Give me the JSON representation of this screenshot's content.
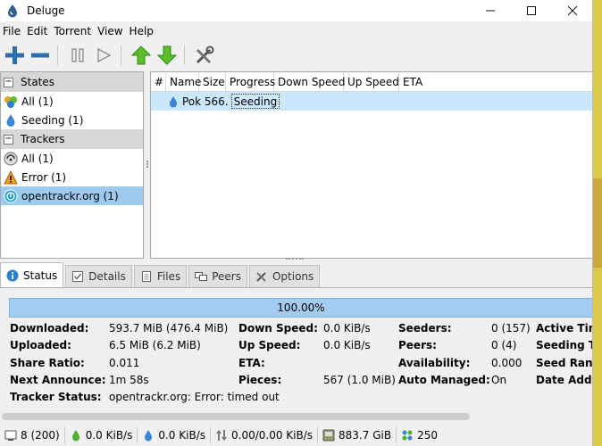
{
  "window": {
    "title": "Deluge"
  },
  "menu": [
    "File",
    "Edit",
    "Torrent",
    "View",
    "Help"
  ],
  "sidebar": {
    "sections": [
      {
        "header": "States",
        "items": [
          {
            "label": "All (1)"
          },
          {
            "label": "Seeding (1)"
          }
        ]
      },
      {
        "header": "Trackers",
        "items": [
          {
            "label": "All (1)"
          },
          {
            "label": "Error (1)"
          },
          {
            "label": "opentrackr.org (1)"
          }
        ]
      }
    ]
  },
  "torrent_list": {
    "columns": [
      "#",
      "Name",
      "Size",
      "Progress",
      "Down Speed",
      "Up Speed",
      "ETA"
    ],
    "rows": [
      {
        "name": "Pok 566.",
        "progress": "Seeding"
      }
    ]
  },
  "tabs": [
    "Status",
    "Details",
    "Files",
    "Peers",
    "Options"
  ],
  "status": {
    "progress_text": "100.00%",
    "fields": {
      "downloaded_label": "Downloaded:",
      "downloaded_value": "593.7 MiB (476.4 MiB)",
      "uploaded_label": "Uploaded:",
      "uploaded_value": "6.5 MiB (6.2 MiB)",
      "share_ratio_label": "Share Ratio:",
      "share_ratio_value": "0.011",
      "next_announce_label": "Next Announce:",
      "next_announce_value": "1m 58s",
      "tracker_status_label": "Tracker Status:",
      "tracker_status_value": "opentrackr.org: Error: timed out",
      "down_speed_label": "Down Speed:",
      "down_speed_value": "0.0 KiB/s",
      "up_speed_label": "Up Speed:",
      "up_speed_value": "0.0 KiB/s",
      "eta_label": "ETA:",
      "pieces_label": "Pieces:",
      "pieces_value": "567 (1.0 MiB)",
      "seeders_label": "Seeders:",
      "seeders_value": "0 (157)",
      "peers_label": "Peers:",
      "peers_value": "0 (4)",
      "availability_label": "Availability:",
      "availability_value": "0.000",
      "auto_managed_label": "Auto Managed:",
      "auto_managed_value": "On",
      "active_time_label": "Active Tim",
      "seeding_time_label": "Seeding Ti",
      "seed_rank_label": "Seed Rank",
      "date_added_label": "Date Adde"
    }
  },
  "statusbar": {
    "connections": "8 (200)",
    "down": "0.0 KiB/s",
    "up": "0.0 KiB/s",
    "protocol": "0.00/0.00 KiB/s",
    "free_space": "883.7 GiB",
    "dht": "250"
  },
  "colors": {
    "selection": "#cce8ff",
    "sidebar_selection": "#9dcbf0",
    "progress": "#a3cdf0",
    "accent_blue": "#1e78c8",
    "green": "#3fae2a"
  }
}
